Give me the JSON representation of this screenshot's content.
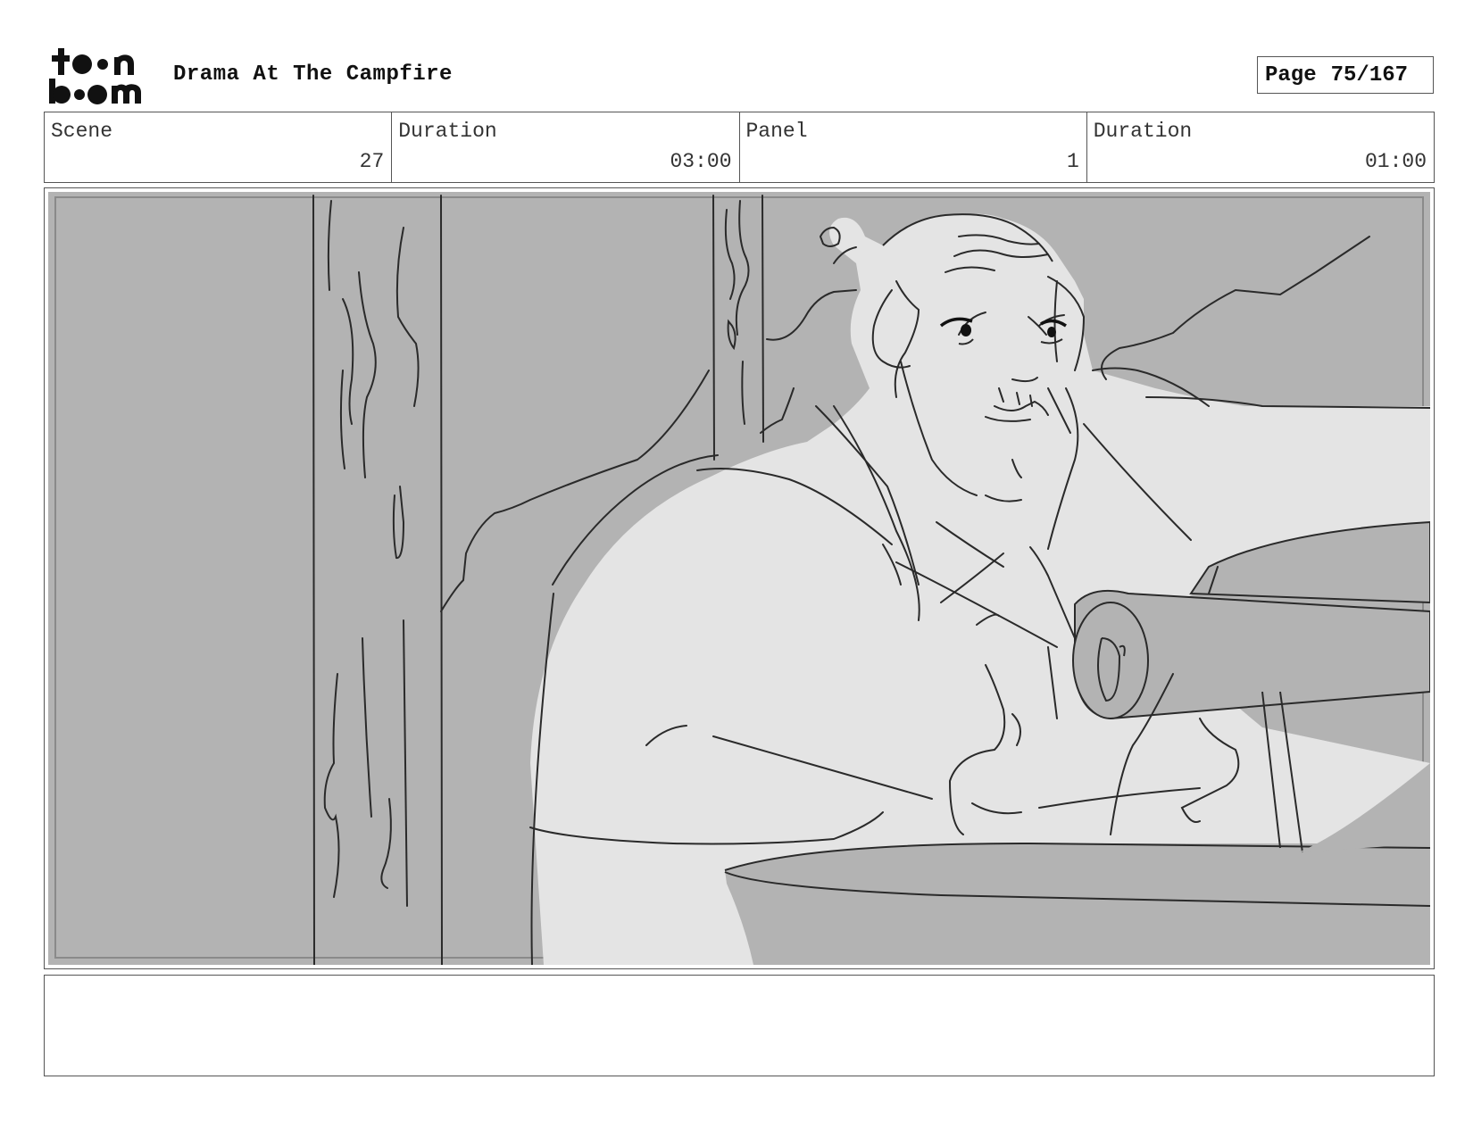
{
  "header": {
    "logo_name": "toon boom",
    "logo_icon": "toon-boom-logo",
    "title": "Drama At The Campfire",
    "page_label": "Page",
    "page_value": "75/167"
  },
  "info": {
    "scene_label": "Scene",
    "scene_value": "27",
    "scene_duration_label": "Duration",
    "scene_duration_value": "03:00",
    "panel_label": "Panel",
    "panel_value": "1",
    "panel_duration_label": "Duration",
    "panel_duration_value": "01:00"
  },
  "panel": {
    "content": "storyboard-sketch",
    "colors": {
      "background": "#b3b3b3",
      "figure": "#e4e4e4",
      "line": "#2a2a2a"
    }
  },
  "notes": {
    "text": ""
  }
}
